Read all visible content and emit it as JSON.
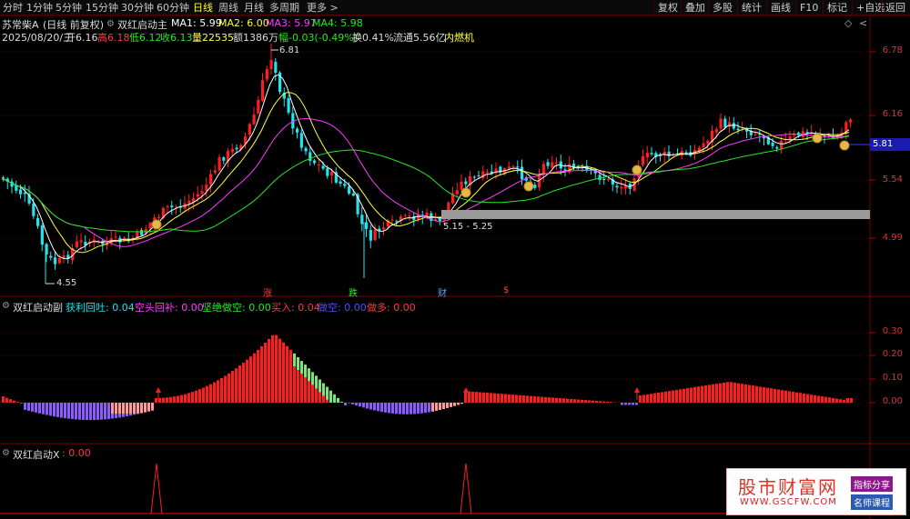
{
  "toolbar": {
    "timeframes": [
      "分时",
      "1分钟",
      "5分钟",
      "15分钟",
      "30分钟",
      "60分钟",
      "日线",
      "周线",
      "月线",
      "多周期",
      "更多 >"
    ],
    "active": "日线",
    "right_buttons": [
      "复权",
      "叠加",
      "多股",
      "统计",
      "画线",
      "F10",
      "标记",
      "+自选",
      "返回"
    ]
  },
  "stock": {
    "name": "苏常柴A",
    "mode": "(日线 前复权)",
    "indicator_main": "双红启动主",
    "ma1": "MA1: 5.99",
    "ma2": "MA2: 6.00",
    "ma3": "MA3: 5.97",
    "ma4": "MA4: 5.98"
  },
  "quote": {
    "date": "2025/08/20/三",
    "open": "开6.16",
    "high": "高6.18",
    "low": "低6.12",
    "close": "收6.13",
    "volume": "量22535",
    "amount": "额1386万",
    "change": "幅-0.03(-0.49%)",
    "turnover": "换0.41%",
    "float_value": "流通5.56亿",
    "sector": "内燃机"
  },
  "colors": {
    "up": "#ff1e1e",
    "down": "#22e4ee",
    "ma1": "#ffffff",
    "ma2": "#ffff3c",
    "ma3": "#ff3cff",
    "ma4": "#28e628",
    "purple": "#8a5cff",
    "pink": "#ff9a9a",
    "green": "#7de27d"
  },
  "main_chart": {
    "y_ticks": [
      "6.78",
      "6.16",
      "5.54",
      "4.99"
    ],
    "current_price_tag": "5.81",
    "high_label": "6.81",
    "low_label": "4.55",
    "zone_label": "5.15 - 5.25",
    "signals": [
      "涨",
      "跌",
      "财",
      "$"
    ]
  },
  "sub1": {
    "title": "双红启动副",
    "items": [
      {
        "label": "获利回吐: 0.04",
        "color": "#22e4ee"
      },
      {
        "label": "空头回补: 0.00",
        "color": "#ff3cff"
      },
      {
        "label": "坚绝做空: 0.00",
        "color": "#28e628"
      },
      {
        "label": "买入: 0.04",
        "color": "#ff1e1e"
      },
      {
        "label": "做空: 0.00",
        "color": "#3c3cff"
      },
      {
        "label": "做多: 0.00",
        "color": "#ff1e1e"
      }
    ],
    "y_ticks": [
      "0.30",
      "0.20",
      "0.10",
      "0.00"
    ]
  },
  "sub2": {
    "title": "双红启动X",
    "value": ": 0.00"
  },
  "watermark": {
    "title": "股市财富网",
    "url": "WWW.GSCFW.COM",
    "badge1": "指标分享",
    "badge2": "名师课程"
  }
}
